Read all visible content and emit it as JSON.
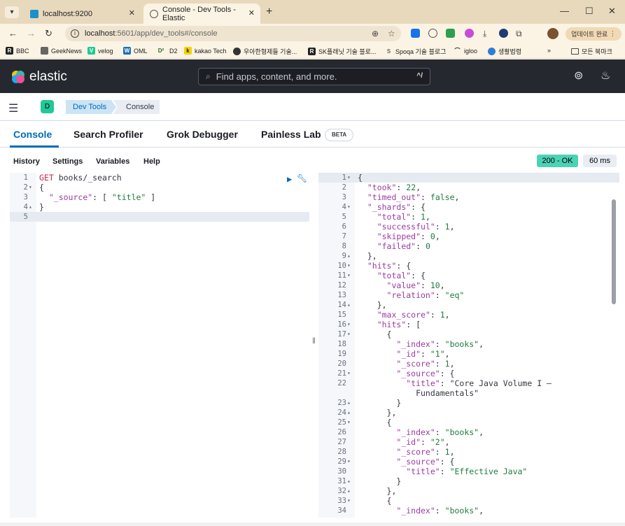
{
  "browser": {
    "tabs": [
      {
        "title": "localhost:9200",
        "active": false
      },
      {
        "title": "Console - Dev Tools - Elastic",
        "active": true
      }
    ],
    "url_host": "localhost",
    "url_rest": ":5601/app/dev_tools#/console",
    "update_label": "업데이트 완료",
    "bookmarks": [
      "BBC",
      "GeekNews",
      "velog",
      "OML",
      "D2",
      "kakao Tech",
      "우아한형제들 기술...",
      "SK플래닛 기술 블로...",
      "Spoqa 기술 블로그",
      "igloo",
      "생활법령"
    ],
    "all_bookmarks_label": "모든 북마크",
    "colors": {
      "tabbar": "#e8d9bd",
      "toolbar": "#fbf3e4"
    }
  },
  "kibana": {
    "logo_text": "elastic",
    "search_placeholder": "Find apps, content, and more.",
    "search_shortcut": "^/",
    "space_badge": "D",
    "breadcrumbs": [
      "Dev Tools",
      "Console"
    ],
    "tabs": [
      "Console",
      "Search Profiler",
      "Grok Debugger",
      "Painless Lab"
    ],
    "beta_label": "BETA",
    "toolbar": [
      "History",
      "Settings",
      "Variables",
      "Help"
    ],
    "status": "200 - OK",
    "time": "60 ms",
    "colors": {
      "header": "#25282f",
      "accent": "#006bb8",
      "status_ok": "#4cd2b4"
    }
  },
  "request": {
    "lines": [
      {
        "n": "1",
        "fold": "",
        "text": "GET books/_search"
      },
      {
        "n": "2",
        "fold": "▾",
        "text": "{"
      },
      {
        "n": "3",
        "fold": "",
        "text": "  \"_source\": [ \"title\" ]"
      },
      {
        "n": "4",
        "fold": "▴",
        "text": "}"
      },
      {
        "n": "5",
        "fold": "",
        "text": ""
      }
    ]
  },
  "response": {
    "lines": [
      {
        "n": "1",
        "fold": "▾",
        "text": "{"
      },
      {
        "n": "2",
        "fold": "",
        "text": "  \"took\": 22,"
      },
      {
        "n": "3",
        "fold": "",
        "text": "  \"timed_out\": false,"
      },
      {
        "n": "4",
        "fold": "▾",
        "text": "  \"_shards\": {"
      },
      {
        "n": "5",
        "fold": "",
        "text": "    \"total\": 1,"
      },
      {
        "n": "6",
        "fold": "",
        "text": "    \"successful\": 1,"
      },
      {
        "n": "7",
        "fold": "",
        "text": "    \"skipped\": 0,"
      },
      {
        "n": "8",
        "fold": "",
        "text": "    \"failed\": 0"
      },
      {
        "n": "9",
        "fold": "▴",
        "text": "  },"
      },
      {
        "n": "10",
        "fold": "▾",
        "text": "  \"hits\": {"
      },
      {
        "n": "11",
        "fold": "▾",
        "text": "    \"total\": {"
      },
      {
        "n": "12",
        "fold": "",
        "text": "      \"value\": 10,"
      },
      {
        "n": "13",
        "fold": "",
        "text": "      \"relation\": \"eq\""
      },
      {
        "n": "14",
        "fold": "▴",
        "text": "    },"
      },
      {
        "n": "15",
        "fold": "",
        "text": "    \"max_score\": 1,"
      },
      {
        "n": "16",
        "fold": "▾",
        "text": "    \"hits\": ["
      },
      {
        "n": "17",
        "fold": "▾",
        "text": "      {"
      },
      {
        "n": "18",
        "fold": "",
        "text": "        \"_index\": \"books\","
      },
      {
        "n": "19",
        "fold": "",
        "text": "        \"_id\": \"1\","
      },
      {
        "n": "20",
        "fold": "",
        "text": "        \"_score\": 1,"
      },
      {
        "n": "21",
        "fold": "▾",
        "text": "        \"_source\": {"
      },
      {
        "n": "22",
        "fold": "",
        "text": "          \"title\": \"Core Java Volume I –"
      },
      {
        "n": "",
        "fold": "",
        "text": "            Fundamentals\""
      },
      {
        "n": "23",
        "fold": "▴",
        "text": "        }"
      },
      {
        "n": "24",
        "fold": "▴",
        "text": "      },"
      },
      {
        "n": "25",
        "fold": "▾",
        "text": "      {"
      },
      {
        "n": "26",
        "fold": "",
        "text": "        \"_index\": \"books\","
      },
      {
        "n": "27",
        "fold": "",
        "text": "        \"_id\": \"2\","
      },
      {
        "n": "28",
        "fold": "",
        "text": "        \"_score\": 1,"
      },
      {
        "n": "29",
        "fold": "▾",
        "text": "        \"_source\": {"
      },
      {
        "n": "30",
        "fold": "",
        "text": "          \"title\": \"Effective Java\""
      },
      {
        "n": "31",
        "fold": "▴",
        "text": "        }"
      },
      {
        "n": "32",
        "fold": "▴",
        "text": "      },"
      },
      {
        "n": "33",
        "fold": "▾",
        "text": "      {"
      },
      {
        "n": "34",
        "fold": "",
        "text": "        \"_index\": \"books\","
      }
    ]
  }
}
